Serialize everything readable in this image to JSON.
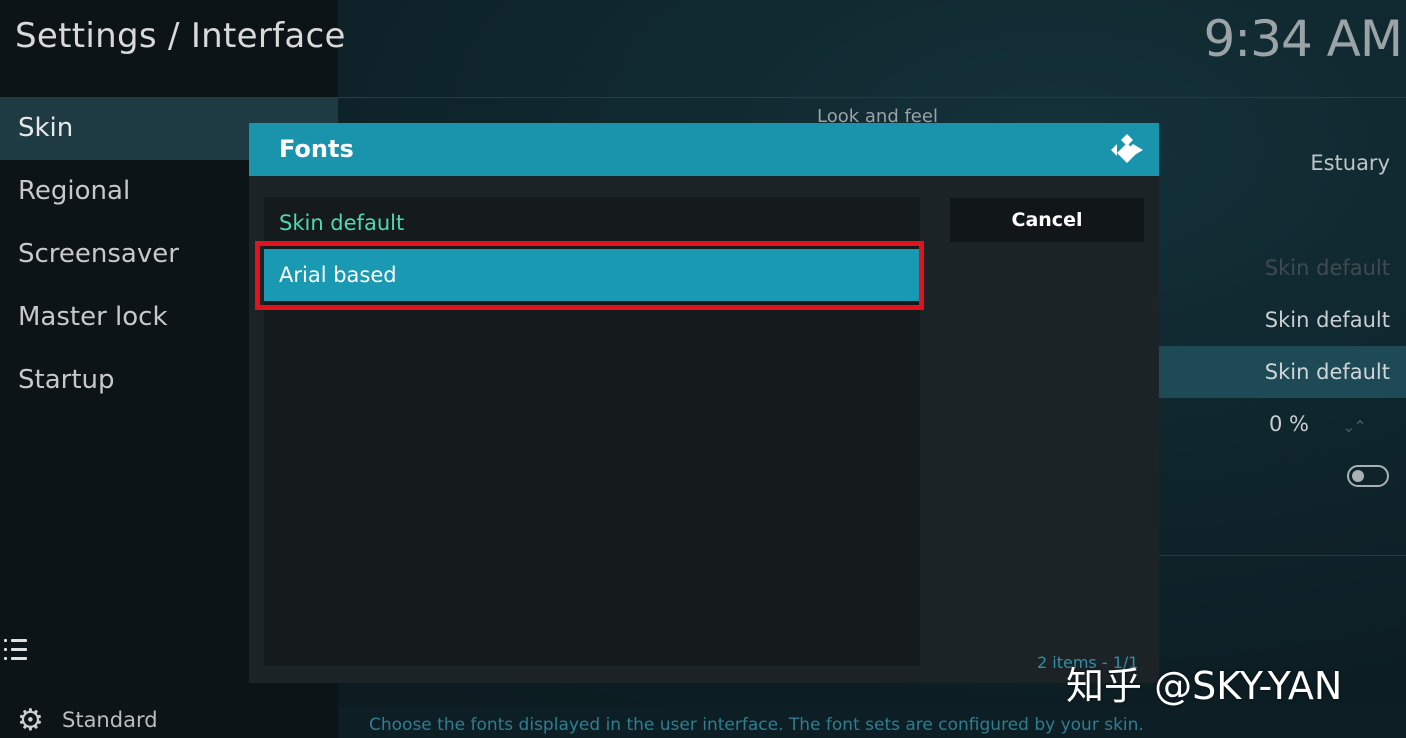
{
  "header": {
    "title": "Settings / Interface",
    "clock": "9:34 AM"
  },
  "sidebar": {
    "items": [
      {
        "label": "Skin"
      },
      {
        "label": "Regional"
      },
      {
        "label": "Screensaver"
      },
      {
        "label": "Master lock"
      },
      {
        "label": "Startup"
      }
    ],
    "level_label": "Standard"
  },
  "settings": {
    "section_header": "Look and feel",
    "values": [
      "Estuary",
      "Skin default",
      "Skin default",
      "Skin default",
      "0 %"
    ]
  },
  "dialog": {
    "title": "Fonts",
    "options": [
      "Skin default",
      "Arial based"
    ],
    "cancel_label": "Cancel",
    "items_info": "2 items - 1/1"
  },
  "footer": {
    "help_text": "Choose the fonts displayed in the user interface. The font sets are configured by your skin."
  },
  "watermark": "知乎 @SKY-YAN",
  "colors": {
    "accent": "#1a93ac",
    "selection": "#1a99b2",
    "default_option": "#4fd9b0",
    "highlight_outline": "#e0141e"
  }
}
